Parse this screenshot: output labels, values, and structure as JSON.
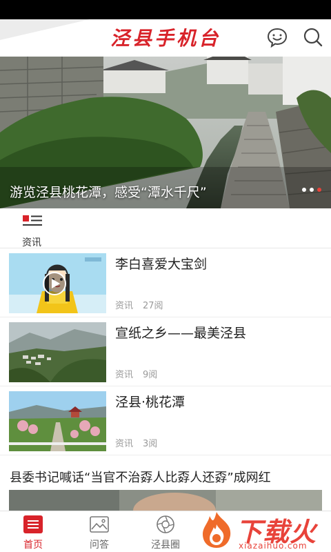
{
  "header": {
    "title": "泾县手机台",
    "chat_icon": "chat-bubble-icon",
    "search_icon": "search-icon"
  },
  "banner": {
    "caption": "游览泾县桃花潭，感受“潭水千尺”",
    "slide_count": 3,
    "active_slide": 3
  },
  "section": {
    "tab_label": "资讯"
  },
  "news": [
    {
      "title": "李白喜爱大宝剑",
      "category": "资讯",
      "reads": "27阅",
      "has_video": true
    },
    {
      "title": "宣纸之乡——最美泾县",
      "category": "资讯",
      "reads": "9阅",
      "has_video": false
    },
    {
      "title": "泾县·桃花潭",
      "category": "资讯",
      "reads": "3阅",
      "has_video": false
    }
  ],
  "headline": {
    "title": "县委书记喊话“当官不治孬人比孬人还孬”成网红"
  },
  "tabbar": {
    "items": [
      {
        "label": "首页",
        "icon": "home-list-icon",
        "active": true
      },
      {
        "label": "问答",
        "icon": "qa-image-icon",
        "active": false
      },
      {
        "label": "泾县圈",
        "icon": "aperture-icon",
        "active": false
      }
    ]
  },
  "watermark": {
    "text": "下载火",
    "sub": "xiazaihuo.com"
  },
  "colors": {
    "brand_red": "#d8232a",
    "accent": "#e8433a",
    "meta_gray": "#999999"
  }
}
